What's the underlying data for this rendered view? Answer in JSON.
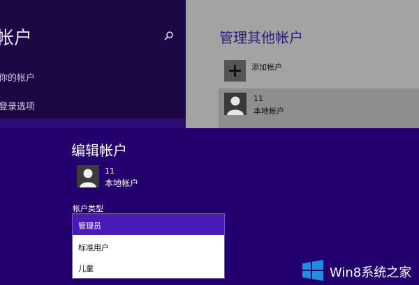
{
  "sidebar": {
    "title": "帐户",
    "items": [
      {
        "label": "你的帐户"
      },
      {
        "label": "登录选项"
      }
    ]
  },
  "main": {
    "title": "管理其他帐户",
    "add_label": "添加帐户",
    "account": {
      "name": "11",
      "type": "本地帐户"
    }
  },
  "dialog": {
    "title": "编辑帐户",
    "account": {
      "name": "11",
      "type": "本地帐户"
    },
    "type_label": "帐户类型",
    "options": [
      {
        "label": "管理员",
        "selected": true
      },
      {
        "label": "标准用户",
        "selected": false
      },
      {
        "label": "儿童",
        "selected": false
      }
    ]
  },
  "watermark": {
    "text": "Win8系统之家"
  },
  "colors": {
    "dialog_bg": "#23006e",
    "selected_option": "#4a1ab8",
    "sidebar_bg": "#1c0845",
    "main_bg": "#a3a3a3",
    "logo_blue": "#1e8fe0"
  },
  "icons": {
    "search": "search-icon",
    "add": "plus-icon",
    "avatar": "user-avatar-icon",
    "logo": "windows-logo-icon"
  }
}
